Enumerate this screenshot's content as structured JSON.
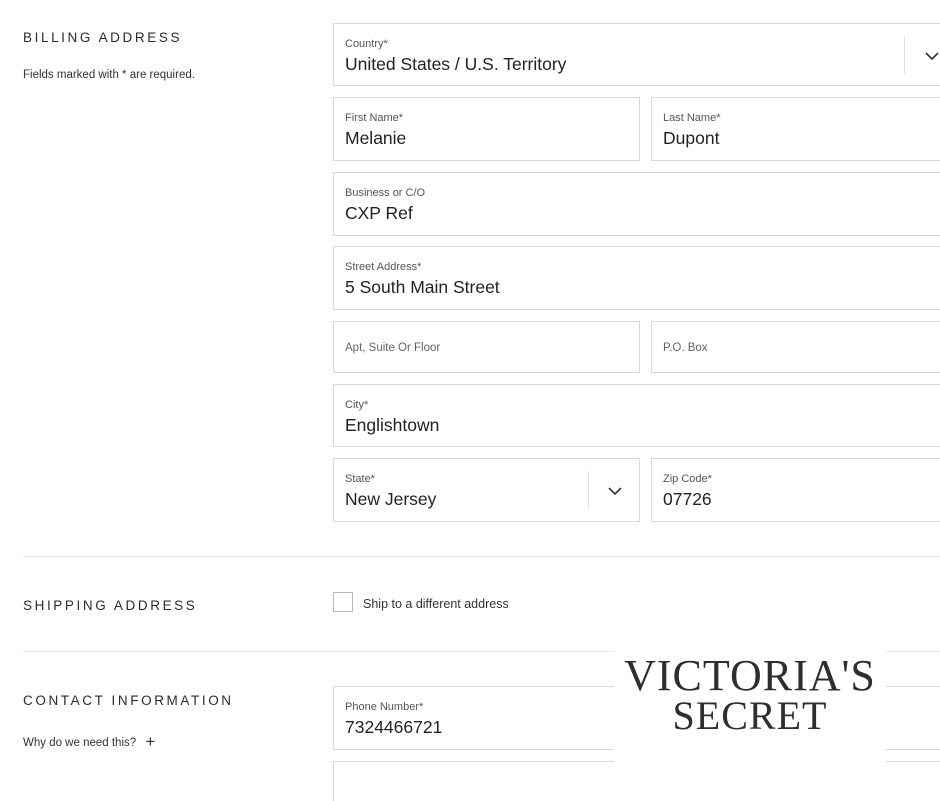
{
  "billing": {
    "title": "BILLING ADDRESS",
    "required_note": "Fields marked with * are required.",
    "country": {
      "label": "Country*",
      "value": "United States / U.S. Territory"
    },
    "first_name": {
      "label": "First Name*",
      "value": "Melanie"
    },
    "last_name": {
      "label": "Last Name*",
      "value": "Dupont"
    },
    "business": {
      "label": "Business or C/O",
      "value": "CXP Ref"
    },
    "street": {
      "label": "Street Address*",
      "value": "5 South Main Street"
    },
    "apt": {
      "placeholder": "Apt, Suite Or Floor"
    },
    "po_box": {
      "placeholder": "P.O. Box"
    },
    "city": {
      "label": "City*",
      "value": "Englishtown"
    },
    "state": {
      "label": "State*",
      "value": "New Jersey"
    },
    "zip": {
      "label": "Zip Code*",
      "value": "07726"
    }
  },
  "shipping": {
    "title": "SHIPPING ADDRESS",
    "checkbox_label": "Ship to a different address",
    "checked": false
  },
  "contact": {
    "title": "CONTACT INFORMATION",
    "why_link": "Why do we need this?",
    "why_icon": "+",
    "phone": {
      "label": "Phone Number*",
      "value": "7324466721"
    }
  },
  "logo": {
    "line1": "VICTORIA'S",
    "line2": "SECRET"
  },
  "icons": {
    "dropdown": "chevron-down-icon",
    "expand": "plus-icon"
  }
}
